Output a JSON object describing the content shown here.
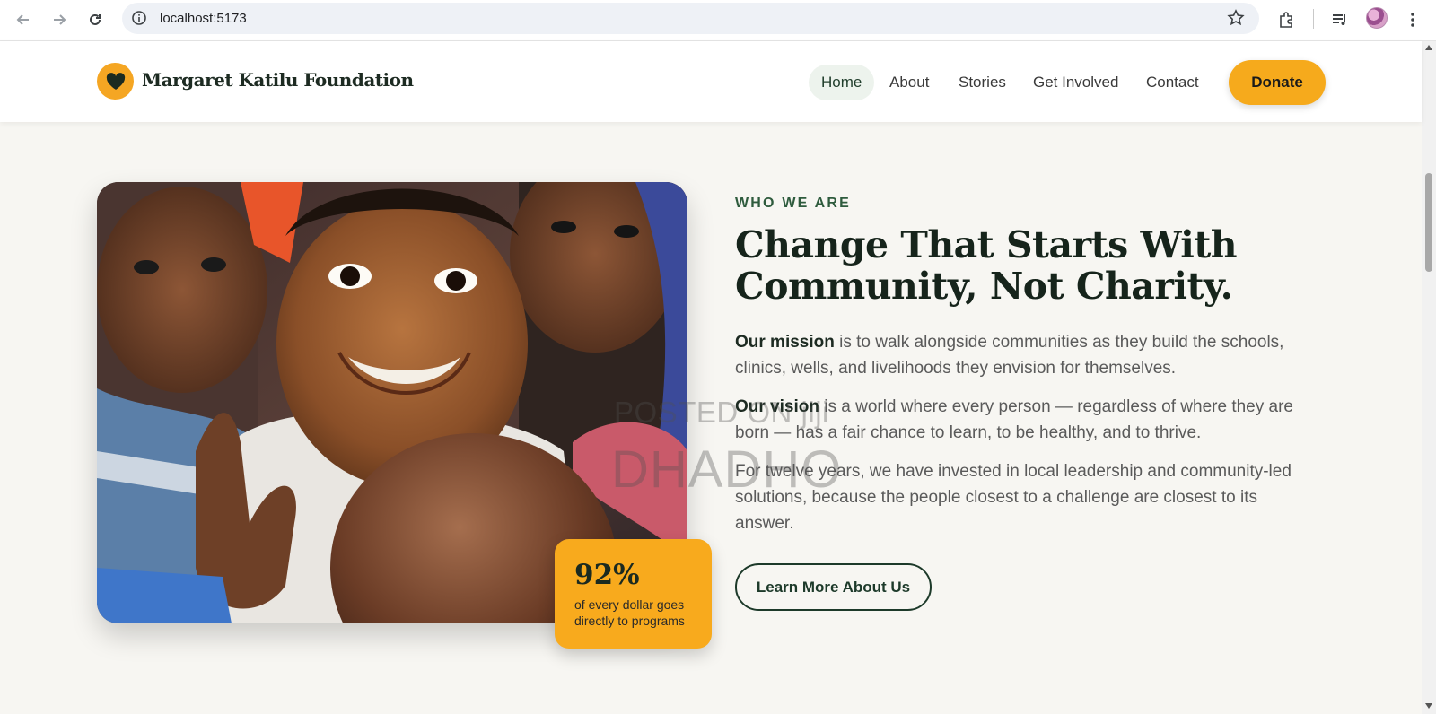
{
  "browser": {
    "url": "localhost:5173",
    "icons": [
      "back-icon",
      "forward-icon",
      "reload-icon",
      "site-info-icon",
      "bookmark-star-icon",
      "extensions-icon",
      "media-control-icon",
      "profile-avatar",
      "menu-icon"
    ]
  },
  "header": {
    "brand": "Margaret Katilu Foundation",
    "nav": [
      {
        "label": "Home",
        "active": true
      },
      {
        "label": "About"
      },
      {
        "label": "Stories"
      },
      {
        "label": "Get Involved"
      },
      {
        "label": "Contact"
      }
    ],
    "donate_label": "Donate"
  },
  "hero": {
    "eyebrow": "WHO WE ARE",
    "headline_line1": "Change That Starts With",
    "headline_line2": "Community, Not Charity.",
    "mission_lead": "Our mission",
    "mission_text": " is to walk alongside communities as they build the schools, clinics, wells, and livelihoods they envision for themselves.",
    "vision_lead": "Our vision",
    "vision_text": " is a world where every person — regardless of where they are born — has a fair chance to learn, to be healthy, and to thrive.",
    "history_text": "For twelve years, we have invested in local leadership and community-led solutions, because the people closest to a challenge are closest to its answer.",
    "cta_label": "Learn More About Us",
    "stat_value": "92%",
    "stat_caption": "of every dollar goes directly to programs"
  },
  "watermark": {
    "line1": "POSTED ON jiji",
    "line2": "DHADHO"
  },
  "colors": {
    "accent": "#f6aa1c",
    "brand_green": "#1d3a2a",
    "page_bg": "#f7f6f2"
  }
}
